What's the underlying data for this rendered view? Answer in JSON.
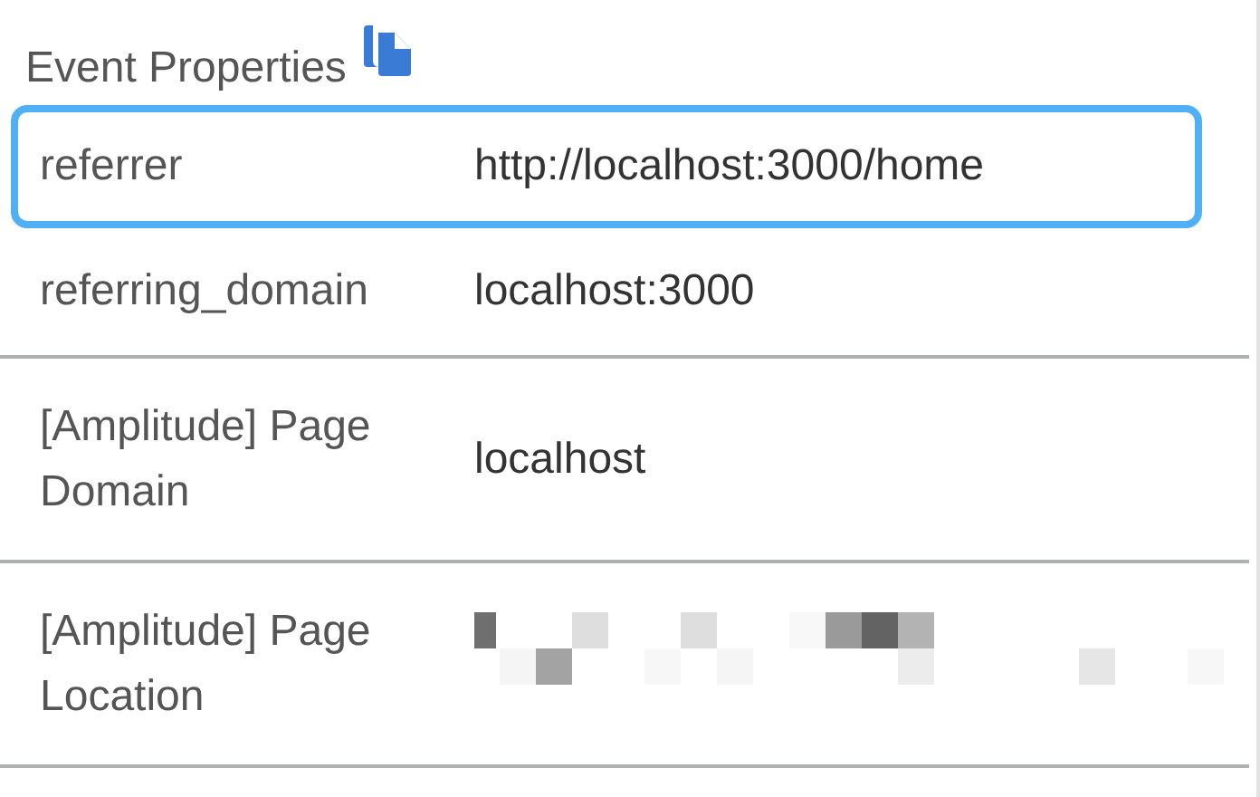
{
  "section": {
    "title": "Event Properties"
  },
  "rows": [
    {
      "key": "referrer",
      "kind": "text",
      "value": "http://localhost:3000/home",
      "highlighted": true
    },
    {
      "key": "referring_domain",
      "kind": "text",
      "value": "localhost:3000",
      "highlighted": false
    },
    {
      "key": "[Amplitude] Page Domain",
      "kind": "text",
      "value": "localhost",
      "highlighted": false
    },
    {
      "key": "[Amplitude] Page Location",
      "kind": "redacted",
      "highlighted": false
    }
  ]
}
